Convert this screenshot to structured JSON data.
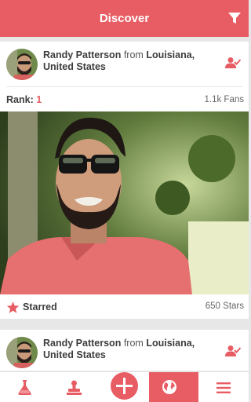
{
  "header": {
    "title": "Discover",
    "filter_icon": "filter-icon"
  },
  "posts": [
    {
      "user_name": "Randy Patterson",
      "from_word": "from",
      "location": "Louisiana, United States",
      "rank_label": "Rank:",
      "rank_value": "1",
      "fans": "1.1k Fans",
      "starred_label": "Starred",
      "stars": "650 Stars"
    },
    {
      "user_name": "Randy Patterson",
      "from_word": "from",
      "location": "Louisiana, United States"
    }
  ],
  "tabbar": {
    "items": [
      "flask-icon",
      "stamp-icon",
      "plus-icon",
      "globe-icon",
      "menu-icon"
    ],
    "active": "globe-icon"
  },
  "colors": {
    "accent": "#e85c64",
    "background": "#e7e7e7"
  }
}
